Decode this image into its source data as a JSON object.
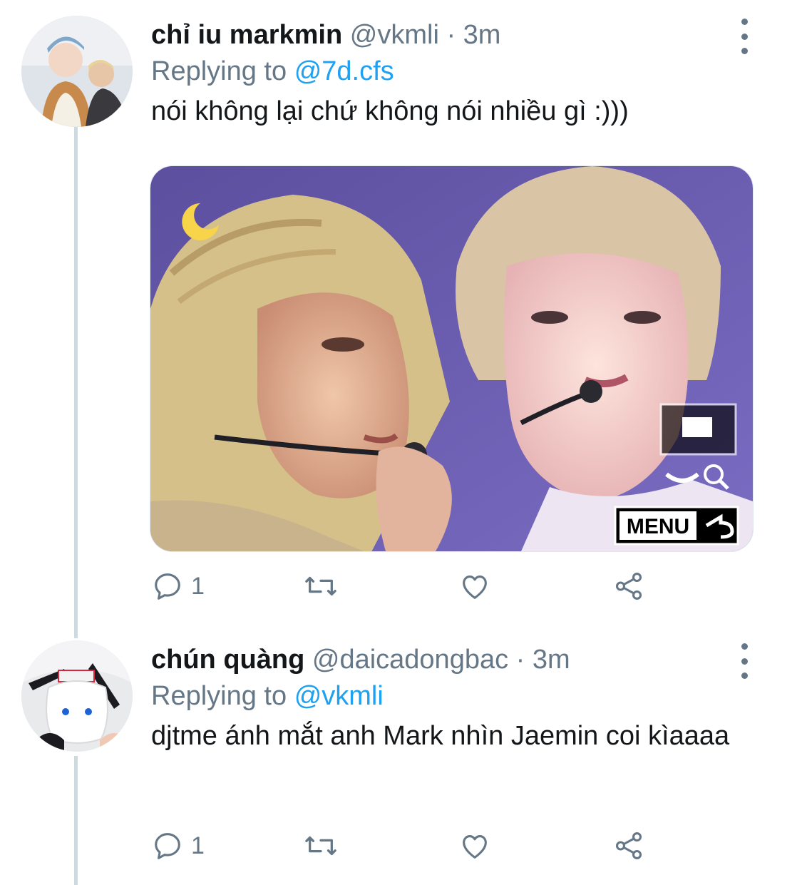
{
  "tweets": [
    {
      "display_name": "chỉ iu markmin",
      "handle": "@vkmli",
      "separator": "·",
      "time": "3m",
      "replying_label": "Replying to",
      "replying_to": "@7d.cfs",
      "text": "nói không lại chứ không nói nhiều gì :)))",
      "avatar_icon": "avatar-photo-icon",
      "media": {
        "overlay_label": "MENU",
        "icons": [
          "crescent-moon-icon",
          "camera-eye-icon",
          "magnifier-icon",
          "back-arrow-icon"
        ]
      },
      "actions": {
        "reply_count": "1"
      }
    },
    {
      "display_name": "chún quàng",
      "handle": "@daicadongbac",
      "separator": "·",
      "time": "3m",
      "replying_label": "Replying to",
      "replying_to": "@vkmli",
      "text": "djtme ánh mắt anh Mark nhìn Jaemin coi kìaaaa",
      "avatar_icon": "avatar-photo-icon",
      "actions": {
        "reply_count": "1"
      }
    }
  ],
  "colors": {
    "link": "#1da1f2",
    "secondary": "#657786",
    "thread_line": "#cfd9de"
  }
}
